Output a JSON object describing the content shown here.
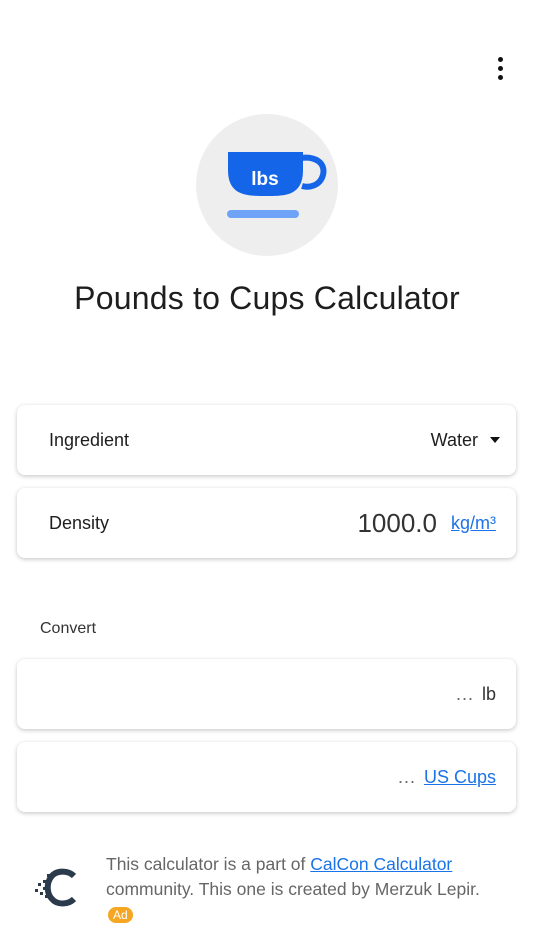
{
  "header": {
    "menu_icon": "more-vert-icon"
  },
  "logo": {
    "cup_text": "lbs",
    "icon": "cup-icon",
    "cup_color": "#1565e8",
    "saucer_color": "#6fa3f7",
    "background": "#eeeeee"
  },
  "title": "Pounds to Cups Calculator",
  "ingredient": {
    "label": "Ingredient",
    "value": "Water",
    "icon": "dropdown-arrow-icon"
  },
  "density": {
    "label": "Density",
    "value": "1000.0",
    "unit": "kg/m³"
  },
  "convert": {
    "section_label": "Convert",
    "pounds": {
      "placeholder": "...",
      "unit": "lb"
    },
    "cups": {
      "placeholder": "...",
      "unit": "US Cups"
    }
  },
  "footer": {
    "logo_icon": "calcon-logo-icon",
    "text_before": "This calculator is a part of ",
    "link": "CalCon Calculator",
    "text_middle": " community. This one is created by Merzuk Lepir. ",
    "badge": "Ad"
  },
  "colors": {
    "accent": "#1a73e8",
    "badge": "#f5a623"
  }
}
